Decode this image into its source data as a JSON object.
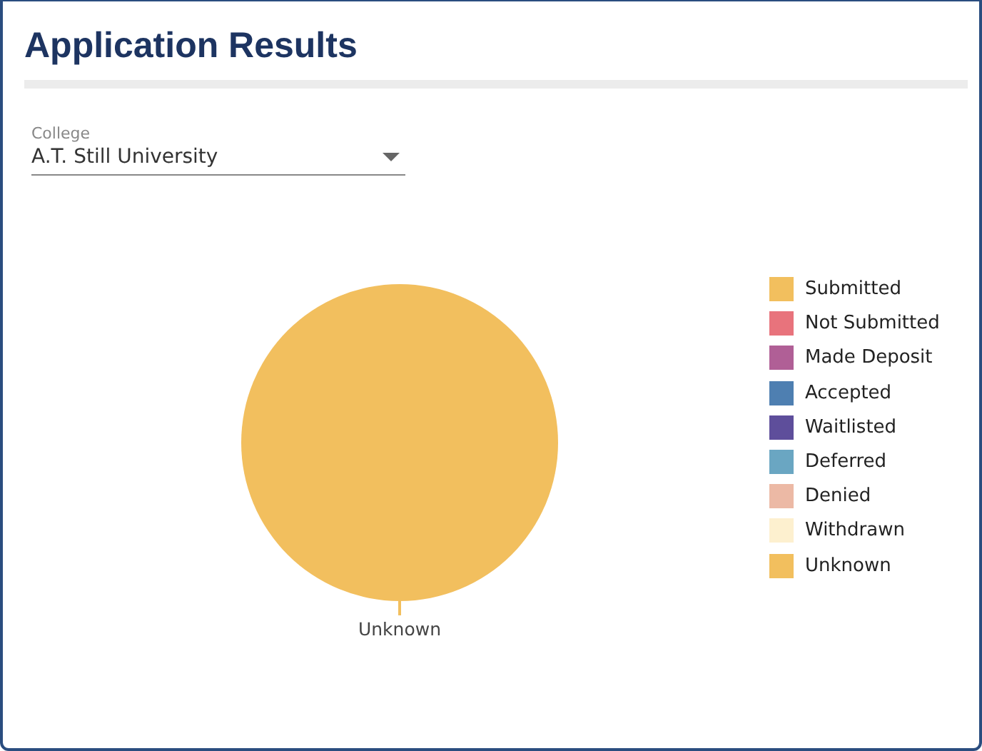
{
  "title": "Application Results",
  "college_select": {
    "label": "College",
    "value": "A.T. Still University"
  },
  "chart_data": {
    "type": "pie",
    "categories": [
      "Submitted",
      "Not Submitted",
      "Made Deposit",
      "Accepted",
      "Waitlisted",
      "Deferred",
      "Denied",
      "Withdrawn",
      "Unknown"
    ],
    "colors": [
      "#f2bf5e",
      "#e8737c",
      "#b05f96",
      "#4e7fb1",
      "#5e4e9b",
      "#6aa6c2",
      "#ecb9a5",
      "#fdf0cf",
      "#f2bf5e"
    ],
    "values": [
      0,
      0,
      0,
      0,
      0,
      0,
      0,
      0,
      1
    ]
  }
}
